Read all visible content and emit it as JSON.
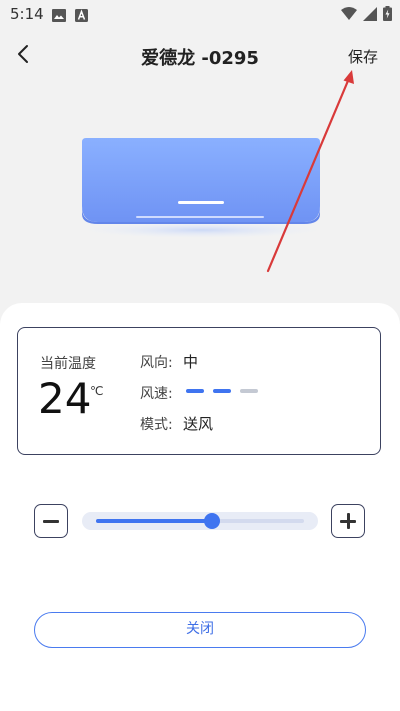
{
  "status_bar": {
    "time": "5:14",
    "left_icons": [
      "image-icon",
      "a-square-icon"
    ],
    "right_icons": [
      "wifi-icon",
      "signal-icon",
      "battery-charging-icon"
    ]
  },
  "header": {
    "title": "爱德龙 -0295",
    "save_label": "保存",
    "back_icon": "chevron-left-icon"
  },
  "device": {
    "current_temp_label": "当前温度",
    "current_temp": "24",
    "temp_unit": "℃",
    "wind_direction_label": "风向:",
    "wind_direction": "中",
    "wind_speed_label": "风速:",
    "wind_speed_level": 2,
    "wind_speed_max": 3,
    "mode_label": "模式:",
    "mode": "送风"
  },
  "slider": {
    "value_fraction": 0.56
  },
  "close_label": "关闭",
  "colors": {
    "accent": "#3f74f0",
    "accent_light": "#c4c9d3",
    "card_border": "#3c4260",
    "annotation": "#d93a3a"
  }
}
